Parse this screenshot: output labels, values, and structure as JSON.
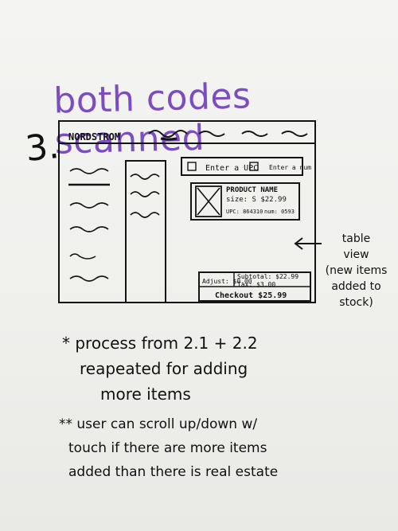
{
  "title": "both codes scanned",
  "step": "3.",
  "wireframe": {
    "brand": "NORDSTROM",
    "search_hint": "Enter a UPC",
    "search_hint_2": "Enter a num",
    "product": {
      "name": "PRODUCT NAME",
      "size": "size: S  $22.99",
      "upc": "UPC: 864310",
      "num": "num: 0593"
    },
    "totals": {
      "adjust": "Adjust: $0.00",
      "subtotal": "Subtotal: $22.99",
      "tax": "Tax: $3.00",
      "checkout": "Checkout $25.99"
    }
  },
  "side_note": [
    "table",
    "view",
    "(new items",
    "added to stock)"
  ],
  "notes": [
    "* process from 2.1 + 2.2",
    "reapeated for adding",
    "more items"
  ],
  "notes2": [
    "** user can scroll up/down w/",
    "touch if there are more items",
    "added than there is real estate"
  ]
}
